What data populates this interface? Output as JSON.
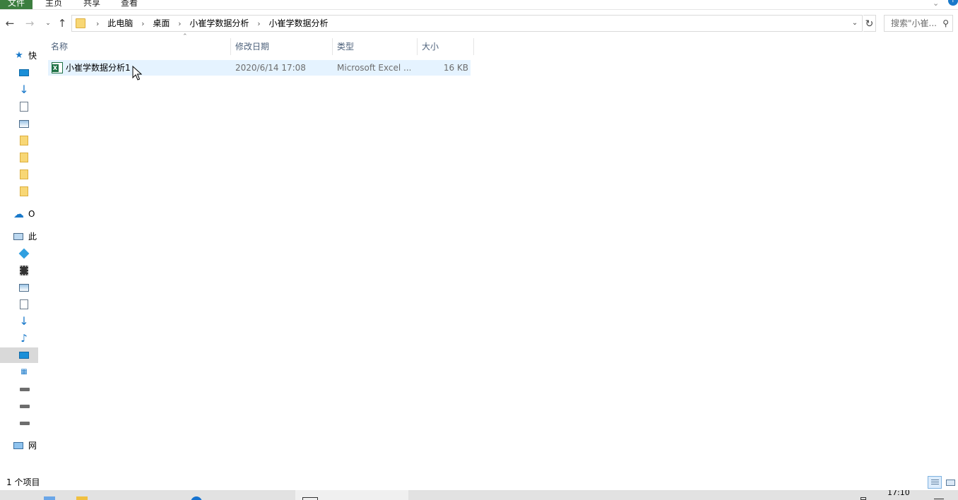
{
  "ribbon": {
    "tabs": [
      {
        "label": "文件"
      },
      {
        "label": "主页"
      },
      {
        "label": "共享"
      },
      {
        "label": "查看"
      }
    ]
  },
  "address": {
    "crumbs": [
      "此电脑",
      "桌面",
      "小崔学数据分析",
      "小崔学数据分析"
    ]
  },
  "search": {
    "placeholder": "搜索\"小崔..."
  },
  "navpane": {
    "items": [
      {
        "label": "快",
        "icon": "star-icon"
      },
      {
        "label": "",
        "icon": "desktop-icon"
      },
      {
        "label": "",
        "icon": "download-icon"
      },
      {
        "label": "",
        "icon": "document-icon"
      },
      {
        "label": "",
        "icon": "pictures-icon"
      },
      {
        "label": "",
        "icon": "folder-icon"
      },
      {
        "label": "",
        "icon": "folder-icon"
      },
      {
        "label": "",
        "icon": "folder-icon"
      },
      {
        "label": "",
        "icon": "folder-icon"
      },
      {
        "label": "O",
        "icon": "onedrive-icon"
      },
      {
        "label": "此",
        "icon": "computer-icon"
      },
      {
        "label": "",
        "icon": "3d-objects-icon"
      },
      {
        "label": "",
        "icon": "video-icon"
      },
      {
        "label": "",
        "icon": "pictures-icon"
      },
      {
        "label": "",
        "icon": "document-icon"
      },
      {
        "label": "",
        "icon": "download-icon"
      },
      {
        "label": "",
        "icon": "music-icon"
      },
      {
        "label": "",
        "icon": "desktop-icon"
      },
      {
        "label": "",
        "icon": "windows-drive-icon"
      },
      {
        "label": "",
        "icon": "drive-icon"
      },
      {
        "label": "",
        "icon": "drive-icon"
      },
      {
        "label": "",
        "icon": "drive-icon"
      },
      {
        "label": "网",
        "icon": "network-icon"
      }
    ]
  },
  "columns": {
    "name": "名称",
    "date": "修改日期",
    "type": "类型",
    "size": "大小"
  },
  "files": [
    {
      "name": "小崔学数据分析1",
      "date": "2020/6/14 17:08",
      "type": "Microsoft Excel ...",
      "size": "16 KB",
      "icon": "excel-file-icon"
    }
  ],
  "status": {
    "count": "1 个项目"
  },
  "taskbar": {
    "time": "17:10"
  }
}
